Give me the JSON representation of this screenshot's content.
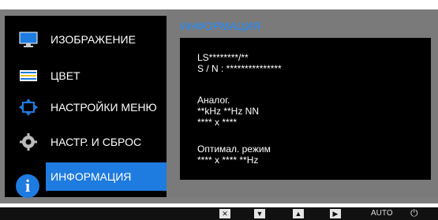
{
  "menu": {
    "items": [
      {
        "label": "ИЗОБРАЖЕНИЕ",
        "icon": "display-icon"
      },
      {
        "label": "ЦВЕТ",
        "icon": "color-bars-icon"
      },
      {
        "label": "НАСТРОЙКИ МЕНЮ",
        "icon": "menu-settings-icon"
      },
      {
        "label": "НАСТР. И СБРОС",
        "icon": "gear-icon"
      },
      {
        "label": "ИНФОРМАЦИЯ",
        "icon": "info-icon"
      }
    ],
    "selected": "ИНФОРМАЦИЯ"
  },
  "info": {
    "title": "ИНФОРМАЦИЯ",
    "model": "LS********/**",
    "serial": "S / N : ***************",
    "source": "Аналог.",
    "frequency": "**kHz **Hz NN",
    "resolution": "**** x ****",
    "optimal_label": "Оптимал. режим",
    "optimal_value": "**** x **** **Hz"
  },
  "bottom_bar": {
    "buttons": [
      {
        "icon": "close-x-icon",
        "glyph": "✕"
      },
      {
        "icon": "down-arrow-icon",
        "glyph": "▼"
      },
      {
        "icon": "up-arrow-icon",
        "glyph": "▲"
      },
      {
        "icon": "right-arrow-icon",
        "glyph": "▶"
      }
    ],
    "auto_label": "AUTO",
    "power_glyph": "⏻"
  },
  "colors": {
    "accent": "#1e7be0",
    "panel_bg": "#000000",
    "frame": "#7d7d7d"
  }
}
